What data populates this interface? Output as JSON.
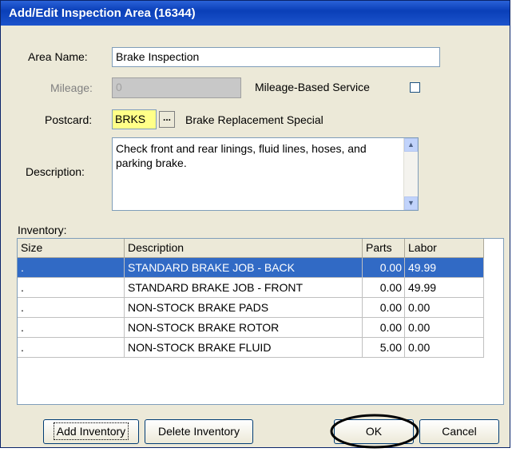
{
  "window": {
    "title": "Add/Edit Inspection Area (16344)"
  },
  "form": {
    "area_name_label": "Area Name:",
    "area_name_value": "Brake Inspection",
    "mileage_label": "Mileage:",
    "mileage_value": "0",
    "mileage_based_label": "Mileage-Based Service",
    "mileage_based_checked": false,
    "postcard_label": "Postcard:",
    "postcard_value": "BRKS",
    "postcard_browse": "...",
    "postcard_desc": "Brake Replacement Special",
    "description_label": "Description:",
    "description_value": "Check front and rear linings, fluid lines, hoses, and parking brake."
  },
  "inventory": {
    "label": "Inventory:",
    "columns": [
      "Size",
      "Description",
      "Parts",
      "Labor"
    ],
    "rows": [
      {
        "size": ".",
        "description": "STANDARD BRAKE JOB - BACK",
        "parts": "0.00",
        "labor": "49.99",
        "selected": true
      },
      {
        "size": ".",
        "description": "STANDARD BRAKE JOB - FRONT",
        "parts": "0.00",
        "labor": "49.99"
      },
      {
        "size": ".",
        "description": "NON-STOCK BRAKE PADS",
        "parts": "0.00",
        "labor": "0.00"
      },
      {
        "size": ".",
        "description": "NON-STOCK BRAKE ROTOR",
        "parts": "0.00",
        "labor": "0.00"
      },
      {
        "size": ".",
        "description": "NON-STOCK BRAKE FLUID",
        "parts": "5.00",
        "labor": "0.00"
      }
    ]
  },
  "buttons": {
    "add_inventory": "Add Inventory",
    "delete_inventory": "Delete Inventory",
    "ok": "OK",
    "cancel": "Cancel"
  }
}
